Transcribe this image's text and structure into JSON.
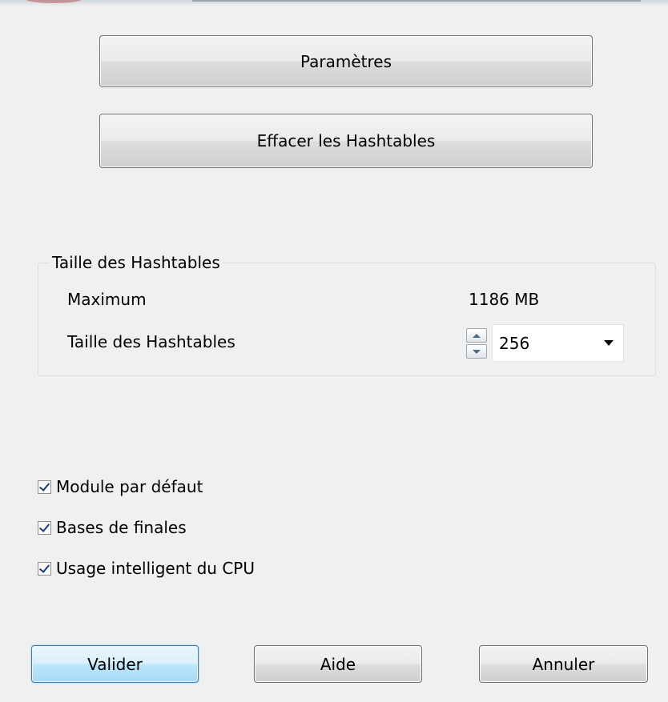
{
  "buttons": {
    "parameters": "Paramètres",
    "clear_hashtables": "Effacer les Hashtables"
  },
  "hashtable_group": {
    "title": "Taille des Hashtables",
    "maximum_label": "Maximum",
    "maximum_value": "1186 MB",
    "size_label": "Taille des Hashtables",
    "size_value": "256"
  },
  "options": [
    {
      "label": "Module par défaut",
      "checked": true
    },
    {
      "label": "Bases de finales",
      "checked": true
    },
    {
      "label": "Usage intelligent du CPU",
      "checked": true
    }
  ],
  "footer": {
    "ok": "Valider",
    "help": "Aide",
    "cancel": "Annuler"
  },
  "colors": {
    "background": "#f0f0f0",
    "default_button_border": "#3c7fb1",
    "checkmark": "#1d3c7a"
  },
  "icons": {
    "spin_up": "triangle-up",
    "spin_down": "triangle-down",
    "dropdown": "triangle-down",
    "checkbox": "check"
  }
}
